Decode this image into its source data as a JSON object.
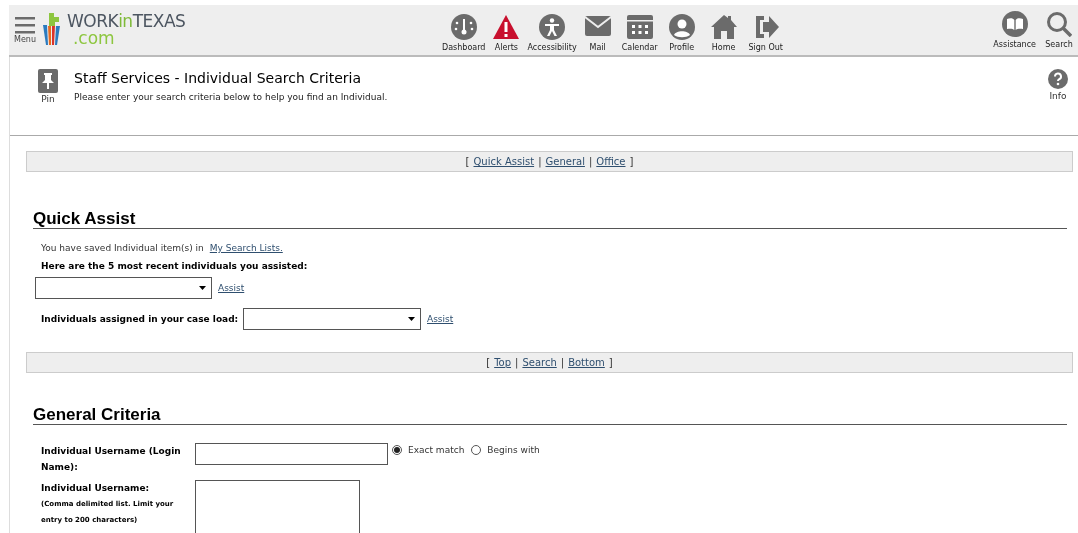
{
  "header": {
    "menu_label": "Menu",
    "logo": {
      "word1": "WORK",
      "word2": "in",
      "word3": "TEXAS",
      "domain": ".com"
    },
    "nav": [
      {
        "kind": "dashboard",
        "label": "Dashboard"
      },
      {
        "kind": "alert",
        "label": "Alerts"
      },
      {
        "kind": "accessibility",
        "label": "Accessibility"
      },
      {
        "kind": "mail",
        "label": "Mail"
      },
      {
        "kind": "calendar",
        "label": "Calendar"
      },
      {
        "kind": "profile",
        "label": "Profile"
      },
      {
        "kind": "home",
        "label": "Home"
      },
      {
        "kind": "signout",
        "label": "Sign Out"
      }
    ],
    "right": [
      {
        "kind": "book",
        "label": "Assistance"
      },
      {
        "kind": "search",
        "label": "Search"
      }
    ]
  },
  "page": {
    "pin_label": "Pin",
    "title": "Staff Services - Individual Search Criteria",
    "subtitle": "Please enter your search criteria below to help you find an Individual.",
    "info_label": "Info"
  },
  "jump_bar_1": {
    "open": "[",
    "close": "]",
    "separator": "|",
    "links": [
      "Quick Assist",
      "General",
      "Office"
    ]
  },
  "quick_assist": {
    "heading": "Quick Assist",
    "saved_text": "You have saved Individual item(s) in",
    "saved_link": "My Search Lists.",
    "recent_label": "Here are the 5 most recent individuals you assisted:",
    "recent_action": "Assist",
    "caseload_label": "Individuals assigned in your case load:",
    "caseload_action": "Assist"
  },
  "jump_bar_2": {
    "open": "[",
    "close": "]",
    "separator": "|",
    "links": [
      "Top",
      "Search",
      "Bottom"
    ]
  },
  "general": {
    "heading": "General Criteria",
    "username_label": "Individual Username (Login Name):",
    "match_options": [
      {
        "label": "Exact match",
        "selected": true
      },
      {
        "label": "Begins with",
        "selected": false
      }
    ],
    "list_label": "Individual Username:",
    "list_hint": "(Comma delimited list. Limit your entry to 200 characters)"
  }
}
